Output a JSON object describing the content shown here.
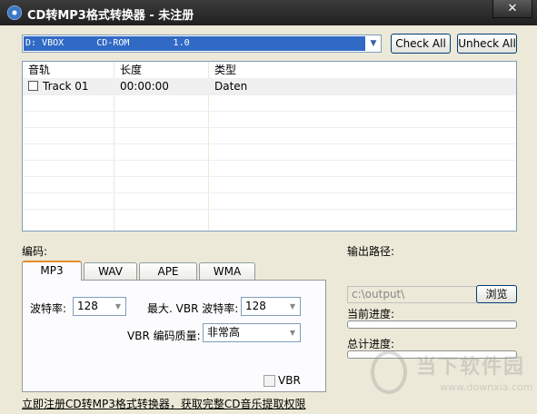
{
  "window": {
    "title": "CD转MP3格式转换器 - 未注册",
    "close_label": "✕"
  },
  "drive": {
    "selected": "D: VBOX      CD-ROM        1.0"
  },
  "buttons": {
    "check_all": "Check All",
    "uncheck_all": "Unheck All",
    "browse": "浏览"
  },
  "tracklist": {
    "columns": [
      "音轨",
      "长度",
      "类型"
    ],
    "rows": [
      {
        "checked": false,
        "track": "Track 01",
        "length": "00:00:00",
        "type": "Daten"
      }
    ]
  },
  "encoding": {
    "label": "编码:",
    "tabs": [
      "MP3",
      "WAV",
      "APE",
      "WMA"
    ],
    "active_tab": "MP3",
    "bitrate_label": "波特率:",
    "bitrate_value": "128",
    "max_vbr_label": "最大. VBR 波特率:",
    "max_vbr_value": "128",
    "vbr_quality_label": "VBR 编码质量:",
    "vbr_quality_value": "非常高",
    "vbr_checkbox_label": "VBR",
    "vbr_checked": false
  },
  "output": {
    "label": "输出路径:",
    "path": "c:\\output\\"
  },
  "progress": {
    "current_label": "当前进度:",
    "current_value": 0,
    "total_label": "总计进度:",
    "total_value": 0
  },
  "register_link": "立即注册CD转MP3格式转换器，获取完整CD音乐提取权限",
  "watermark": {
    "text": "当下软件园",
    "url": "www.downxia.com"
  }
}
